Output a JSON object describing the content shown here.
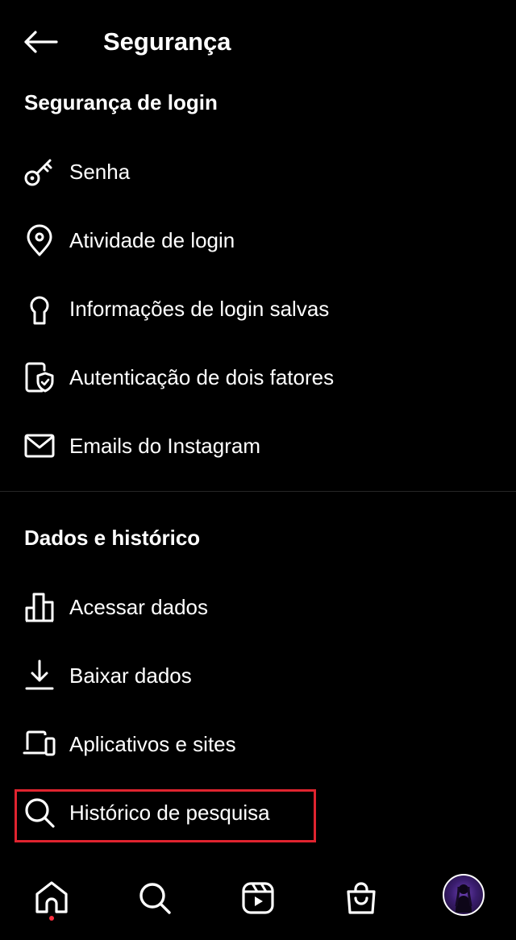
{
  "header": {
    "title": "Segurança"
  },
  "sections": [
    {
      "title": "Segurança de login",
      "items": [
        {
          "label": "Senha",
          "icon": "key-icon"
        },
        {
          "label": "Atividade de login",
          "icon": "location-pin-icon"
        },
        {
          "label": "Informações de login salvas",
          "icon": "keyhole-icon"
        },
        {
          "label": "Autenticação de dois fatores",
          "icon": "device-shield-icon"
        },
        {
          "label": "Emails do Instagram",
          "icon": "envelope-icon"
        }
      ]
    },
    {
      "title": "Dados e histórico",
      "items": [
        {
          "label": "Acessar dados",
          "icon": "bar-chart-icon"
        },
        {
          "label": "Baixar dados",
          "icon": "download-icon"
        },
        {
          "label": "Aplicativos e sites",
          "icon": "devices-icon"
        },
        {
          "label": "Histórico de pesquisa",
          "icon": "search-icon"
        }
      ]
    }
  ],
  "bottom_nav": [
    {
      "icon": "home-icon",
      "active": true
    },
    {
      "icon": "search-icon"
    },
    {
      "icon": "reels-icon"
    },
    {
      "icon": "shop-bag-icon"
    },
    {
      "icon": "profile-avatar"
    }
  ],
  "colors": {
    "background": "#000000",
    "text": "#ffffff",
    "highlight": "#e0242f",
    "notification_dot": "#ff3040"
  }
}
